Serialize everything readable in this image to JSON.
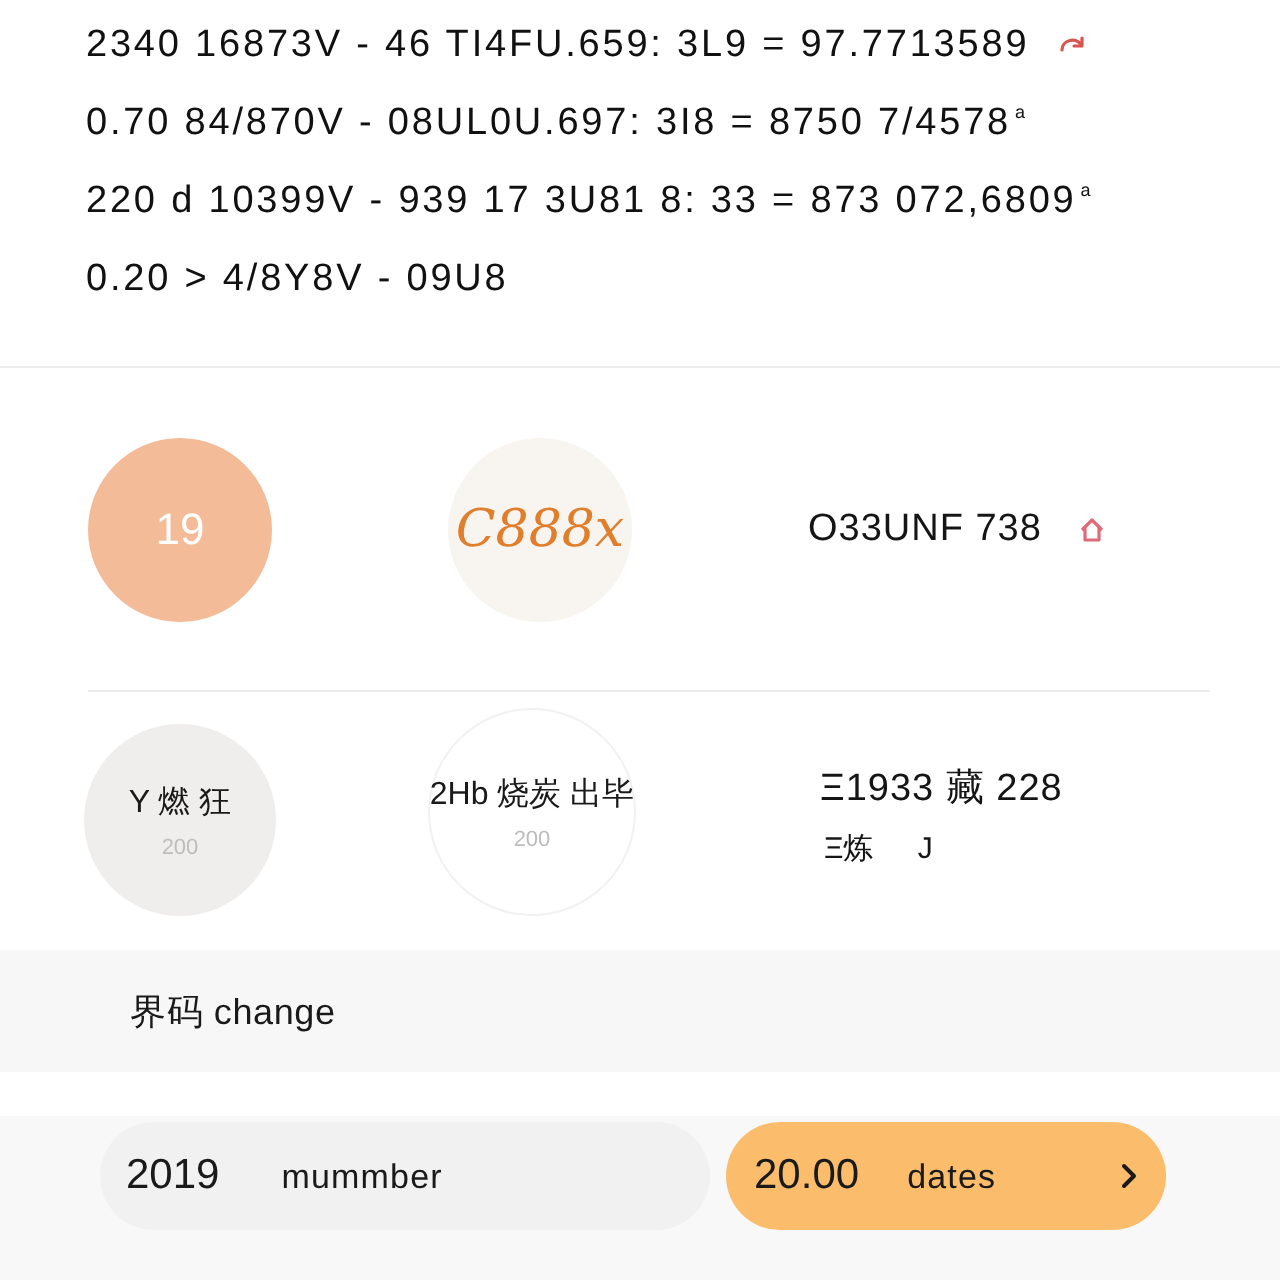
{
  "result_lines": [
    {
      "kind": "icon",
      "text": "2340 16873V - 46 TI4FU.659: 3L9 = 97.7713589"
    },
    {
      "kind": "plain",
      "text": "0.70 84/870V - 08UL0U.697: 3I8 = 8750 7/4578$^{a}$"
    },
    {
      "kind": "plain",
      "text": "220 d 10399V - 939 17 3U81 8: 33 = 873 072,6809$^{a}$"
    },
    {
      "kind": "plain",
      "text": "0.20 > 4/8Y8V - 09U8"
    }
  ],
  "stats": [
    {
      "kind": "filled",
      "label": "19"
    },
    {
      "kind": "soft",
      "label": "C888x"
    },
    {
      "kind": "text",
      "label": "O33UNF 738",
      "icon": true
    }
  ],
  "details": [
    {
      "kind": "grey",
      "label": "Y 燃 狂",
      "sub": "200"
    },
    {
      "kind": "outlined",
      "label": "2Hb 烧炭 出毕",
      "sub": "200"
    },
    {
      "kind": "text",
      "label": "Ξ1933 藏 228",
      "sub": "Ξ炼 J"
    }
  ],
  "section_bar": {
    "label": "界码 change"
  },
  "footer": {
    "pills": [
      {
        "kind": "plain",
        "value": "2019",
        "label": "mummber"
      },
      {
        "kind": "accent",
        "value": "20.00",
        "label": "dates"
      }
    ]
  }
}
